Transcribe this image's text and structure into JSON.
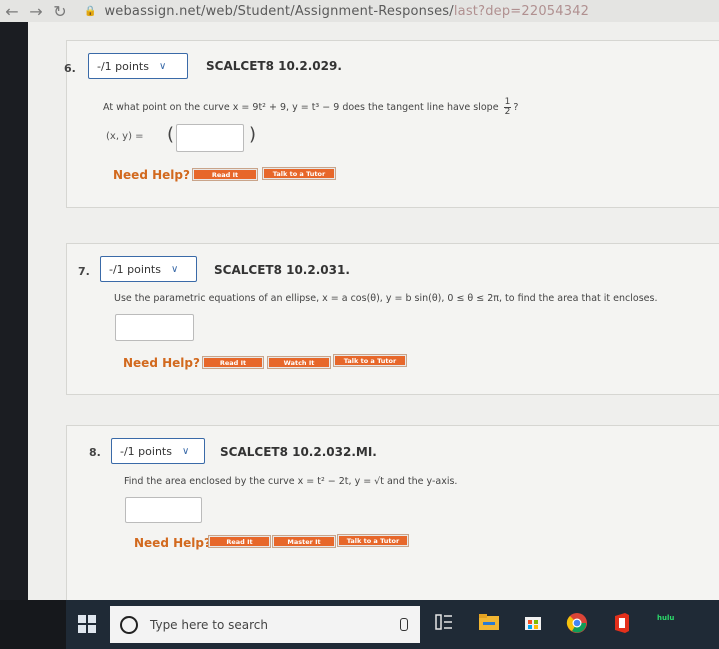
{
  "browser": {
    "url_main": "webassign.net/web/Student/Assignment-Responses/",
    "url_dim": "last?dep=22054342"
  },
  "questions": [
    {
      "number": "6.",
      "points": "-/1 points",
      "code": "SCALCET8 10.2.029.",
      "text_prefix": "At what point on the curve ",
      "text_x": "x = 9t² + 9,",
      "text_y": "y = t³ − 9",
      "text_mid": " does the tangent line have slope ",
      "slope_num": "1",
      "slope_den": "2",
      "text_end": "?",
      "answer_label": "(x, y) =",
      "need_help": "Need Help?",
      "buttons": [
        "Read It",
        "Talk to a Tutor"
      ]
    },
    {
      "number": "7.",
      "points": "-/1 points",
      "code": "SCALCET8 10.2.031.",
      "text": "Use the parametric equations of an ellipse,  x = a cos(θ),  y = b sin(θ),  0 ≤ θ ≤ 2π,  to find the area that it encloses.",
      "need_help": "Need Help?",
      "buttons": [
        "Read It",
        "Watch It",
        "Talk to a Tutor"
      ]
    },
    {
      "number": "8.",
      "points": "-/1 points",
      "code": "SCALCET8 10.2.032.MI.",
      "text": "Find the area enclosed by the curve  x = t² − 2t,  y = √t  and the y-axis.",
      "need_help": "Need Help?",
      "buttons": [
        "Read It",
        "Master It",
        "Talk to a Tutor"
      ]
    }
  ],
  "taskbar": {
    "search_placeholder": "Type here to search",
    "hulu_label": "hulu"
  },
  "colors": {
    "accent_orange": "#e7672a",
    "need_help": "#d2691e",
    "points_border": "#3a6aa8"
  }
}
